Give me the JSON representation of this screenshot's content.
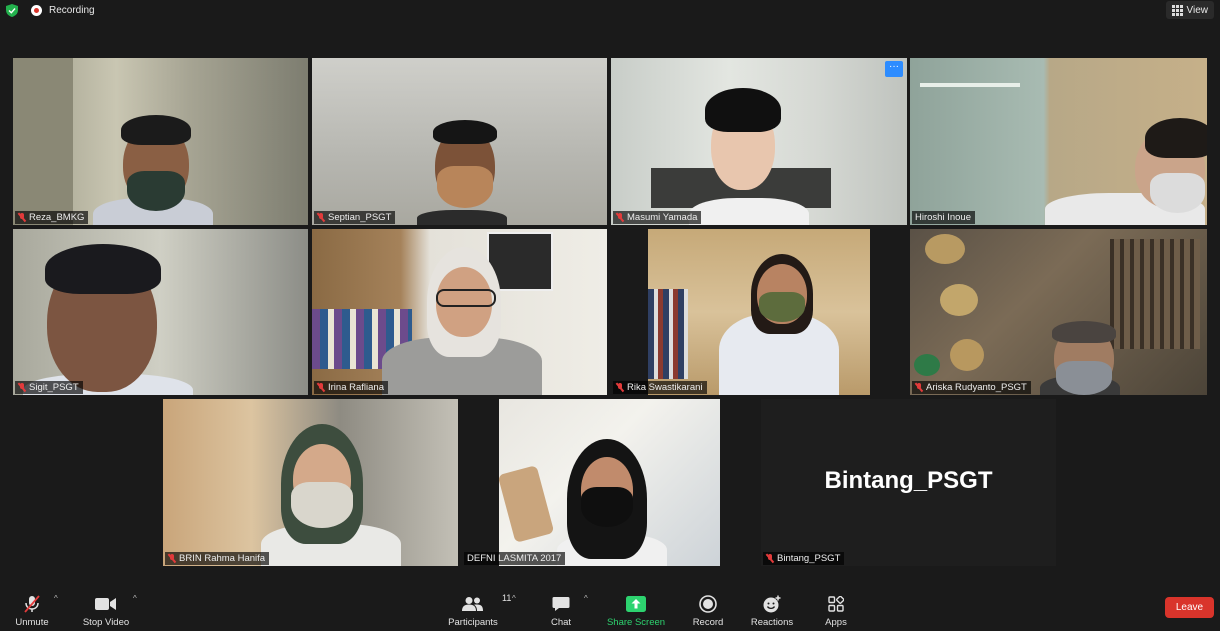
{
  "topbar": {
    "recording_label": "Recording",
    "view_label": "View"
  },
  "participants": [
    {
      "name": "Reza_BMKG",
      "muted": true,
      "video": true
    },
    {
      "name": "Septian_PSGT",
      "muted": true,
      "video": true
    },
    {
      "name": "Masumi Yamada",
      "muted": true,
      "video": true,
      "more_menu": "···"
    },
    {
      "name": "Hiroshi Inoue",
      "muted": false,
      "video": true,
      "active_speaker": true
    },
    {
      "name": "Sigit_PSGT",
      "muted": true,
      "video": true
    },
    {
      "name": "Irina Rafliana",
      "muted": true,
      "video": true
    },
    {
      "name": "Rika Swastikarani",
      "muted": true,
      "video": true
    },
    {
      "name": "Ariska Rudyanto_PSGT",
      "muted": true,
      "video": true
    },
    {
      "name": "BRIN Rahma Hanifa",
      "muted": true,
      "video": true
    },
    {
      "name": "DEFNI LASMITA 2017",
      "muted": false,
      "video": true
    },
    {
      "name": "Bintang_PSGT",
      "muted": true,
      "video": false,
      "display_name": "Bintang_PSGT"
    }
  ],
  "toolbar": {
    "unmute": "Unmute",
    "stop_video": "Stop Video",
    "participants": "Participants",
    "participants_count": "11",
    "chat": "Chat",
    "share_screen": "Share Screen",
    "record": "Record",
    "reactions": "Reactions",
    "apps": "Apps",
    "leave": "Leave"
  },
  "colors": {
    "active_speaker_border": "#d6e26a",
    "share_green": "#2dd36f",
    "leave_red": "#d9342b",
    "accent_blue": "#2d8cff"
  }
}
